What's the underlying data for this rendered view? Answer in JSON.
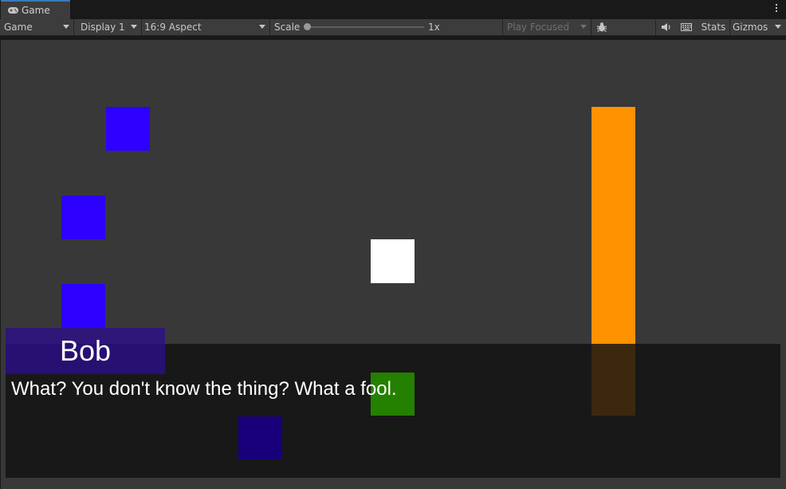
{
  "window": {
    "tab_label": "Game",
    "tab_icon": "gamepad-icon"
  },
  "toolbar": {
    "mode_select": "Game",
    "display_select": "Display 1",
    "aspect_select": "16:9 Aspect",
    "scale_label": "Scale",
    "scale_value": "1x",
    "play_mode_select": "Play Focused",
    "stats_label": "Stats",
    "gizmos_label": "Gizmos",
    "icons": [
      "bug-icon",
      "audio-mute-icon",
      "keyboard-icon",
      "kebab-menu-icon"
    ]
  },
  "game": {
    "colors": {
      "background": "#383838",
      "blue_tile": "#2e00ff",
      "white_tile": "#ffffff",
      "green_tile": "#248000",
      "orange_bar": "#ff9200",
      "dialogue_panel": "#161616",
      "name_box": "#2b0e8c"
    },
    "dialogue": {
      "speaker": "Bob",
      "text_before": "What? You don't know the thing? What a ",
      "text_highlight": "fool."
    }
  }
}
